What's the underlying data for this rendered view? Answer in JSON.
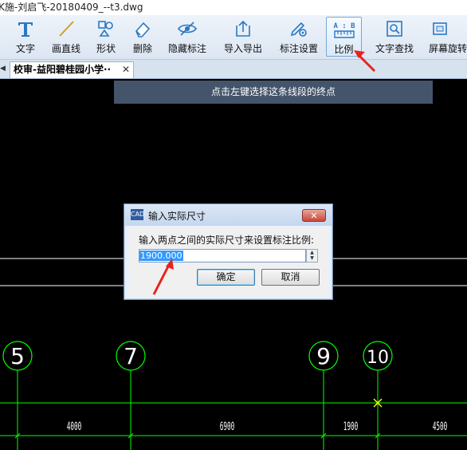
{
  "window": {
    "title": "K施-刘启飞-20180409_--t3.dwg"
  },
  "toolbar": {
    "items": [
      {
        "label": "文字",
        "icon": "text-icon"
      },
      {
        "label": "画直线",
        "icon": "line-icon"
      },
      {
        "label": "形状",
        "icon": "shape-icon"
      },
      {
        "label": "删除",
        "icon": "eraser-icon"
      },
      {
        "label": "隐藏标注",
        "icon": "eye-hidden-icon"
      },
      {
        "label": "导入导出",
        "icon": "import-export-icon"
      },
      {
        "label": "标注设置",
        "icon": "annotation-settings-icon"
      },
      {
        "label": "比例",
        "icon": "scale-icon",
        "icon_text": "A : B"
      },
      {
        "label": "文字查找",
        "icon": "text-search-icon"
      },
      {
        "label": "屏幕旋转",
        "icon": "screen-rotate-icon"
      }
    ]
  },
  "tabs": [
    {
      "label": "校审-益阳碧桂园小学··",
      "close": "✕"
    }
  ],
  "hint": {
    "text": "点击左键选择这条线段的终点"
  },
  "drawing": {
    "axes": [
      "5",
      "7",
      "9",
      "10"
    ],
    "dimensions": [
      "4000",
      "6900",
      "1900",
      "4500"
    ]
  },
  "dialog": {
    "title": "输入实际尺寸",
    "app_icon_text": "CAD",
    "prompt": "输入两点之间的实际尺寸来设置标注比例:",
    "input_value": "1900.000",
    "ok_label": "确定",
    "cancel_label": "取消",
    "close_glyph": "✕",
    "spin_up": "▲",
    "spin_down": "▼"
  },
  "colors": {
    "canvas": "#000000",
    "grid": "#00ff00",
    "hint_bg": "#44546b",
    "annotation_arrow": "#e8231a",
    "marker": "#ffff00"
  }
}
